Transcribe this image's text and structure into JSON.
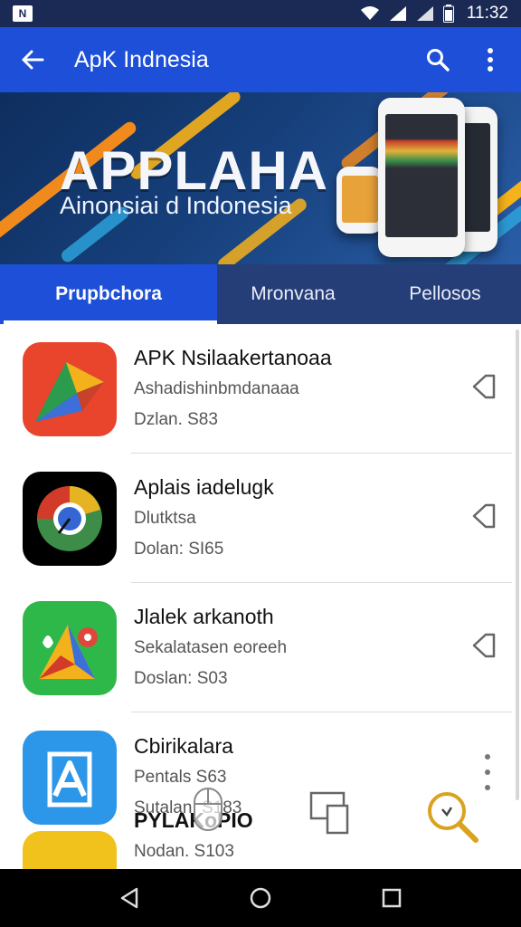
{
  "status_bar": {
    "notification": "N",
    "time": "11:32",
    "icons": [
      "wifi-icon",
      "signal-icon",
      "signal-icon",
      "battery-icon"
    ]
  },
  "app_bar": {
    "title": "ApK Indnesia",
    "back_icon": "arrow-left-icon",
    "search_icon": "search-icon",
    "menu_icon": "more-vert-icon"
  },
  "banner": {
    "title": "APPLAHA",
    "subtitle": "Ainonsiai d Indonesia"
  },
  "tabs": [
    {
      "label": "Prupbchora",
      "active": true
    },
    {
      "label": "Mronvana",
      "active": false
    },
    {
      "label": "Pellosos",
      "active": false
    }
  ],
  "apps": [
    {
      "name": "APK Nsilaakertanoaa",
      "sub": "Ashadishinbmdanaaa",
      "size": "Dzlan. S83",
      "action_icon": "pin-icon"
    },
    {
      "name": "Aplais iadelugk",
      "sub": "Dlutktsa",
      "size": "Dolan: SI65",
      "action_icon": "pin-icon"
    },
    {
      "name": "Jlalek arkanoth",
      "sub": "Sekalatasen eoreeh",
      "size": "Doslan: S03",
      "action_icon": "pin-icon"
    },
    {
      "name": "Cbirikalara",
      "sub": "Pentals S63",
      "size": "Sutalan. S183",
      "action_icon": "more-vert-icon"
    }
  ],
  "overlay": {
    "label": "PYLAKoPIO",
    "last_size": "Nodan. S103"
  },
  "nav_bar": {
    "icons": [
      "nav-back-icon",
      "nav-home-icon",
      "nav-recents-icon"
    ]
  },
  "colors": {
    "app_bar": "#1d4fd8",
    "tabs_bg": "#263e78",
    "status_bar": "#1b2a55"
  }
}
